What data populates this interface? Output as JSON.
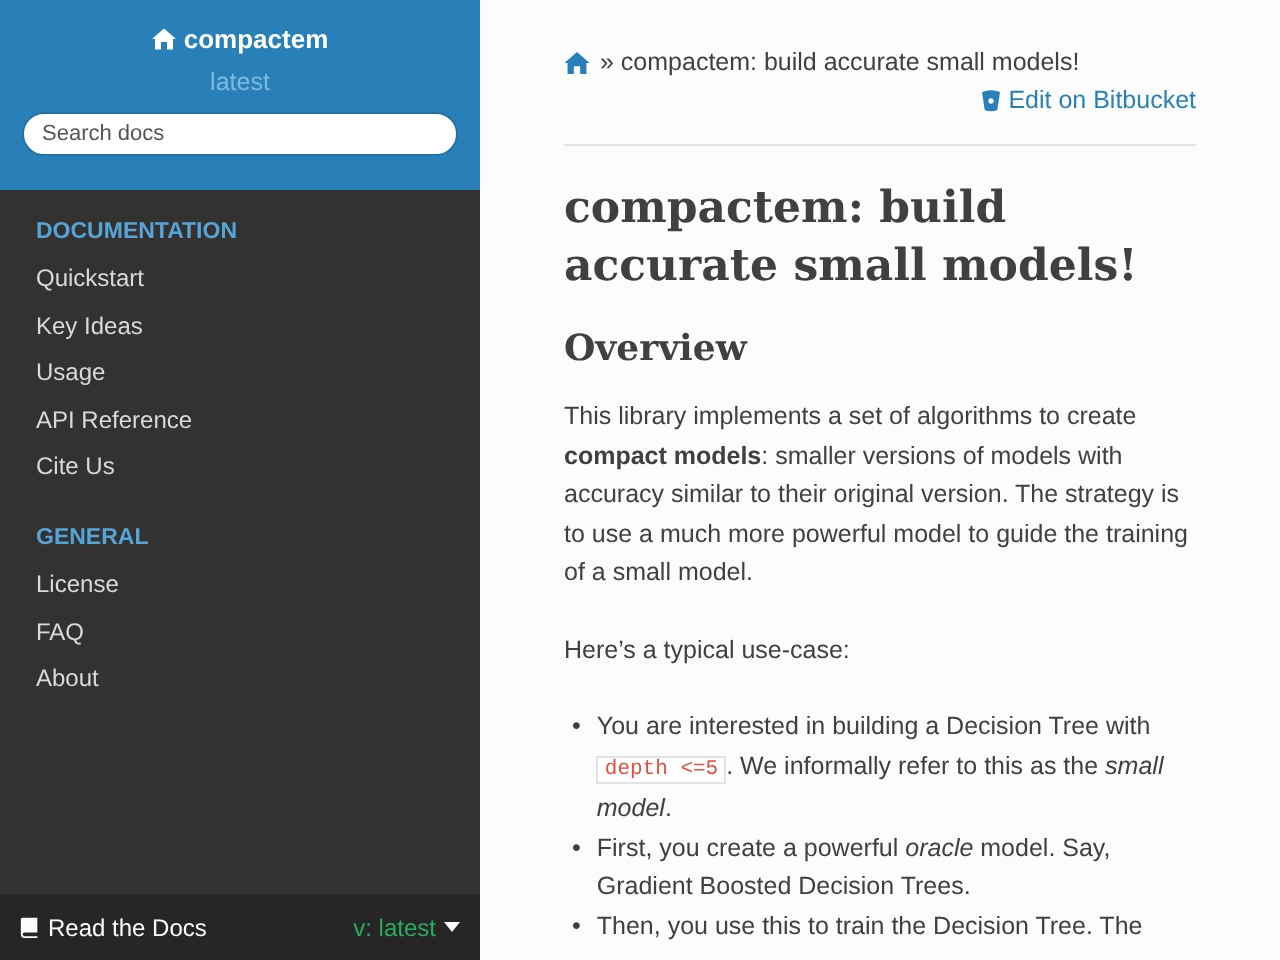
{
  "sidebar": {
    "project": "compactem",
    "version": "latest",
    "search": {
      "placeholder": "Search docs"
    },
    "sections": [
      {
        "caption": "DOCUMENTATION",
        "items": [
          "Quickstart",
          "Key Ideas",
          "Usage",
          "API Reference",
          "Cite Us"
        ]
      },
      {
        "caption": "GENERAL",
        "items": [
          "License",
          "FAQ",
          "About"
        ]
      }
    ],
    "footer": {
      "label": "Read the Docs",
      "version": "v: latest"
    }
  },
  "breadcrumb": {
    "current": "» compactem: build accurate small models!",
    "edit_link": "Edit on Bitbucket"
  },
  "content": {
    "title": "compactem: build accurate small models!",
    "section_title": "Overview",
    "paragraphs": [
      "This library implements a set of algorithms to create **compact models**: smaller versions of models with accuracy similar to their original version. The strategy is to use a much more powerful model to guide the training of a small model.",
      "Here’s a typical use-case:"
    ],
    "bullets": [
      {
        "marker": "•",
        "before": "You are interested in building a Decision Tree with ",
        "code": "depth <=5",
        "after": ". We informally refer to this as the *small model*."
      },
      {
        "marker": "•",
        "before": "First, you create a powerful *oracle* model. Say, Gradient Boosted Decision Trees."
      },
      {
        "marker": "•",
        "before": "Then, you use this to train the Decision Tree. The"
      }
    ]
  }
}
